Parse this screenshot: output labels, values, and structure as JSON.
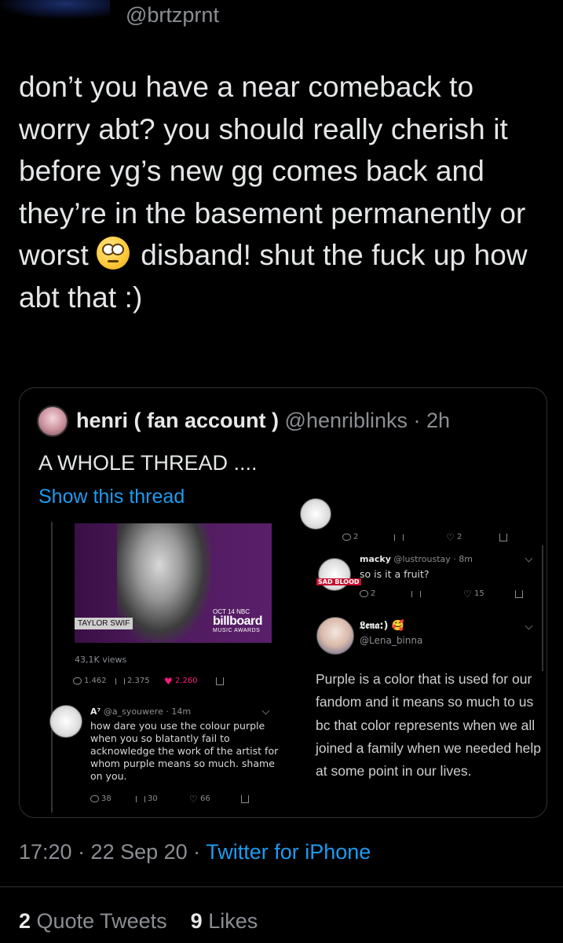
{
  "tweet": {
    "handle": "@brtzprnt",
    "text_part1": "don’t you have a near comeback to worry abt? you should really cherish it before yg’s new gg comes back and they’re in the basement permanently or worst",
    "text_part2": "disband! shut the fuck up how abt that :)",
    "emoji": "face-with-rolling-eyes-icon"
  },
  "quote": {
    "name": "henri ( fan account )",
    "handle": "@henriblinks",
    "time": "· 2h",
    "text": "A WHOLE THREAD ....",
    "show_thread": "Show this thread",
    "left_panel": {
      "video_caption": "TAYLOR SWIF",
      "bb_date": "OCT 14 NBC",
      "bb_name": "billboard",
      "bb_awards": "MUSIC AWARDS",
      "views": "43,1K views",
      "stats": {
        "replies": "1.462",
        "retweets": "2.375",
        "likes": "2.260"
      },
      "reply": {
        "name": "A⁷",
        "handle": "@a_syouwere",
        "time": "· 14m",
        "text": "how dare you use the colour purple when you so blatantly fail to acknowledge the work of the artist for whom purple means so much. shame on you.",
        "stats": {
          "replies": "38",
          "retweets": "30",
          "likes": "66"
        }
      }
    },
    "right_panel": {
      "top_stats": {
        "replies": "2",
        "likes": "2"
      },
      "macky": {
        "name": "macky",
        "handle": "@lustroustay",
        "time": "· 8m",
        "text": "so is it a fruit?",
        "badge": "SAD BLOOD",
        "stats": {
          "replies": "2",
          "likes": "15"
        }
      },
      "lena": {
        "name": "𝕷𝖊𝖓𝖆:)",
        "handle": "@Lena_binna",
        "text": "Purple is a color that is used for our fandom and it means so much to us bc that color represents when we all joined a family when we needed help at some point in our lives."
      }
    }
  },
  "meta": {
    "time": "17:20 · 22 Sep 20 ·",
    "source": "Twitter for iPhone"
  },
  "counts": {
    "quote_tweets_num": "2",
    "quote_tweets_label": "Quote Tweets",
    "likes_num": "9",
    "likes_label": "Likes"
  },
  "colors": {
    "link": "#1d9bf0",
    "like_pink": "#f91880"
  }
}
